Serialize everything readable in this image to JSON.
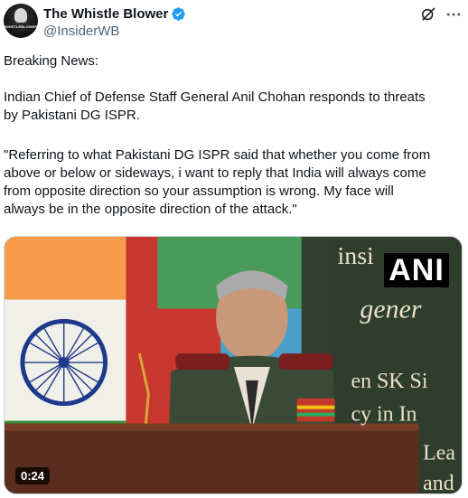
{
  "author": {
    "display_name": "The Whistle Blower",
    "handle": "@InsiderWB",
    "avatar_text": "WHISTLEBLOWER"
  },
  "icons": {
    "verified": "verified-badge-icon",
    "grok": "grok-icon",
    "more": "more-options-icon"
  },
  "post": {
    "line1": "Breaking News:",
    "line2": "Indian Chief of Defense Staff General Anil Chohan responds to threats\nby Pakistani DG ISPR.",
    "line3": "\"Referring to what Pakistani DG ISPR said that whether you come from\nabove or below or sideways, i want to reply that India will always come\nfrom opposite direction so your assumption is wrong. My face will\nalways be in the opposite direction of the attack.\""
  },
  "media": {
    "watermark": "ANI",
    "duration": "0:24",
    "background_text": [
      "insi",
      "gener",
      "en SK Si",
      "cy in In",
      "Lea",
      "and"
    ]
  },
  "colors": {
    "verified_blue": "#1d9bf0",
    "text": "#0f1419",
    "secondary_text": "#536471"
  }
}
